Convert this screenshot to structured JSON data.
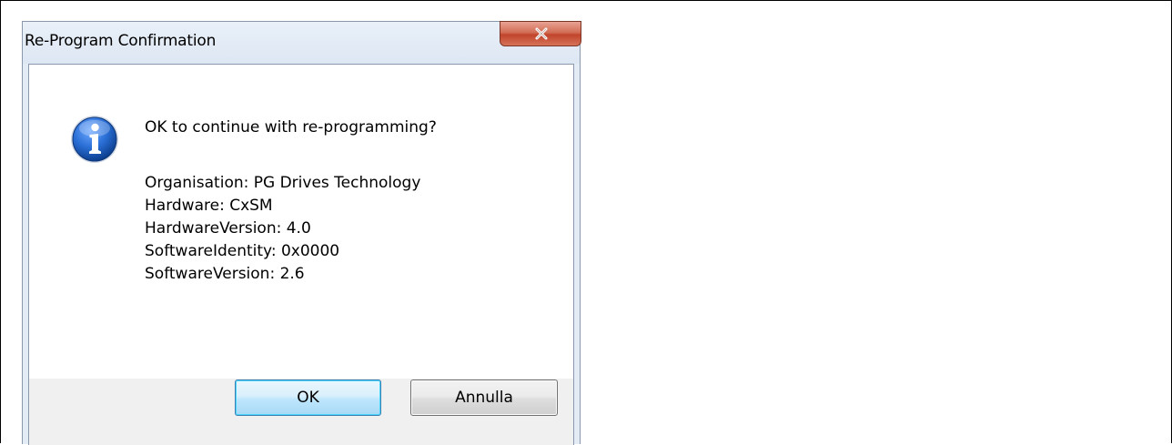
{
  "dialog": {
    "title": "Re-Program Confirmation",
    "close_icon": "close-icon",
    "message_icon": "information-icon",
    "main_instruction": "OK to continue with re-programming?",
    "details": [
      "Organisation: PG Drives Technology",
      "Hardware: CxSM",
      "HardwareVersion: 4.0",
      "SoftwareIdentity: 0x0000",
      "SoftwareVersion: 2.6"
    ],
    "buttons": {
      "ok_label": "OK",
      "cancel_label": "Annulla"
    }
  },
  "colors": {
    "close_button": "#c1442b",
    "info_icon": "#1e5fbf",
    "default_button_border": "#3c7fb1"
  }
}
